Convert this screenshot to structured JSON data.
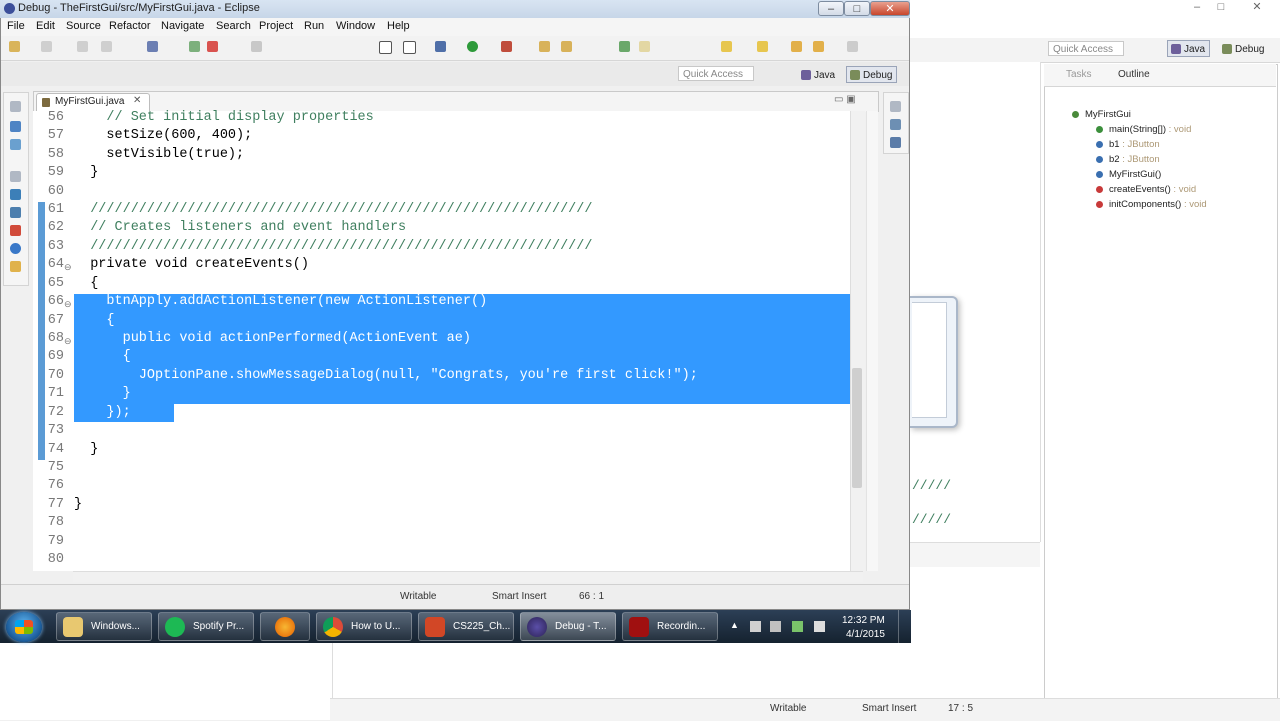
{
  "bg": {
    "quick_access": "Quick Access",
    "persp_java": "Java",
    "persp_debug": "Debug",
    "tabs_label": "Tasks",
    "outline_label": "Outline",
    "tree": [
      {
        "label": "MyFirstGui",
        "type": ""
      },
      {
        "label": "main(String[])",
        "type": " : void"
      },
      {
        "label": "b1",
        "type": " : JButton"
      },
      {
        "label": "b2",
        "type": " : JButton"
      },
      {
        "label": "MyFirstGui()",
        "type": ""
      },
      {
        "label": "createEvents()",
        "type": " : void"
      },
      {
        "label": "initComponents()",
        "type": " : void"
      }
    ],
    "slashes": "/////",
    "status": {
      "writable": "Writable",
      "insert": "Smart Insert",
      "position": "17 : 5"
    }
  },
  "window": {
    "title": "Debug - TheFirstGui/src/MyFirstGui.java - Eclipse",
    "minimize": "–",
    "maximize": "□",
    "close": "✕"
  },
  "menu": [
    "File",
    "Edit",
    "Source",
    "Refactor",
    "Navigate",
    "Search",
    "Project",
    "Run",
    "Window",
    "Help"
  ],
  "toolbar": {
    "quick_access": "Quick Access",
    "persp_java": "Java",
    "persp_debug": "Debug"
  },
  "editor": {
    "tab_label": "MyFirstGui.java",
    "tab_close": "✕",
    "minmax": "▭ ▣",
    "lines": [
      {
        "n": "56",
        "code": "    // Set initial display properties"
      },
      {
        "n": "57",
        "code": "    setSize(600, 400);"
      },
      {
        "n": "58",
        "code": "    setVisible(true);"
      },
      {
        "n": "59",
        "code": "  }"
      },
      {
        "n": "60",
        "code": ""
      },
      {
        "n": "61",
        "code": "  //////////////////////////////////////////////////////////////"
      },
      {
        "n": "62",
        "code": "  // Creates listeners and event handlers"
      },
      {
        "n": "63",
        "code": "  //////////////////////////////////////////////////////////////"
      },
      {
        "n": "64",
        "code": "  private void createEvents()"
      },
      {
        "n": "65",
        "code": "  {"
      },
      {
        "n": "66",
        "code": "    btnApply.addActionListener(new ActionListener()"
      },
      {
        "n": "67",
        "code": "    {"
      },
      {
        "n": "68",
        "code": "      public void actionPerformed(ActionEvent ae)"
      },
      {
        "n": "69",
        "code": "      {"
      },
      {
        "n": "70",
        "code": "        JOptionPane.showMessageDialog(null, \"Congrats, you're first click!\");"
      },
      {
        "n": "71",
        "code": "      }"
      },
      {
        "n": "72",
        "code": "    });"
      },
      {
        "n": "73",
        "code": ""
      },
      {
        "n": "74",
        "code": "  }"
      },
      {
        "n": "75",
        "code": ""
      },
      {
        "n": "76",
        "code": ""
      },
      {
        "n": "77",
        "code": "}"
      },
      {
        "n": "78",
        "code": ""
      },
      {
        "n": "79",
        "code": ""
      },
      {
        "n": "80",
        "code": ""
      }
    ]
  },
  "status": {
    "writable": "Writable",
    "insert": "Smart Insert",
    "position": "66 : 1"
  },
  "taskbar": {
    "buttons": [
      {
        "label": "Windows...",
        "color": "#e8c870"
      },
      {
        "label": "Spotify Pr...",
        "color": "#1db954"
      },
      {
        "label": "",
        "color": "#e66000"
      },
      {
        "label": "How to U...",
        "color": "#dd4b39"
      },
      {
        "label": "CS225_Ch...",
        "color": "#d24726"
      },
      {
        "label": "Debug - T...",
        "color": "#2c2255"
      },
      {
        "label": "Recordin...",
        "color": "#a01010"
      }
    ],
    "time": "12:32 PM",
    "date": "4/1/2015"
  }
}
